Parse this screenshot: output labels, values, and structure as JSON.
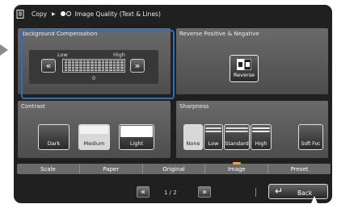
{
  "header": {
    "crumb_copy": "Copy",
    "crumb_sep": "▶",
    "crumb_quality": "Image Quality (Text & Lines)",
    "dot_colors": [
      "#ffffff",
      "#1a1a1a"
    ]
  },
  "background_compensation": {
    "title": "Background Compensation",
    "low_label": "Low",
    "high_label": "High",
    "decrease_icon": "«",
    "increase_icon": "»",
    "value": "0"
  },
  "reverse": {
    "title": "Reverse Positive & Negative",
    "button_label": "Reverse",
    "icon": "reverse-icon"
  },
  "contrast": {
    "title": "Contrast",
    "options": [
      "Dark",
      "Medium",
      "Light"
    ],
    "selected": "Medium"
  },
  "sharpness": {
    "title": "Sharpness",
    "options": [
      "None",
      "Low",
      "Standard",
      "High",
      "Soft Foc"
    ],
    "selected": "None"
  },
  "tabs": {
    "items": [
      "Scale",
      "Paper",
      "Original",
      "Image",
      "Preset"
    ],
    "active": "Image"
  },
  "pager": {
    "prev_icon": "«",
    "next_icon": "»",
    "text": "1 / 2"
  },
  "back": {
    "label": "Back",
    "icon": "↵"
  },
  "colors": {
    "highlight": "#2a6fc0",
    "active_tab_marker": "#f0a030"
  }
}
